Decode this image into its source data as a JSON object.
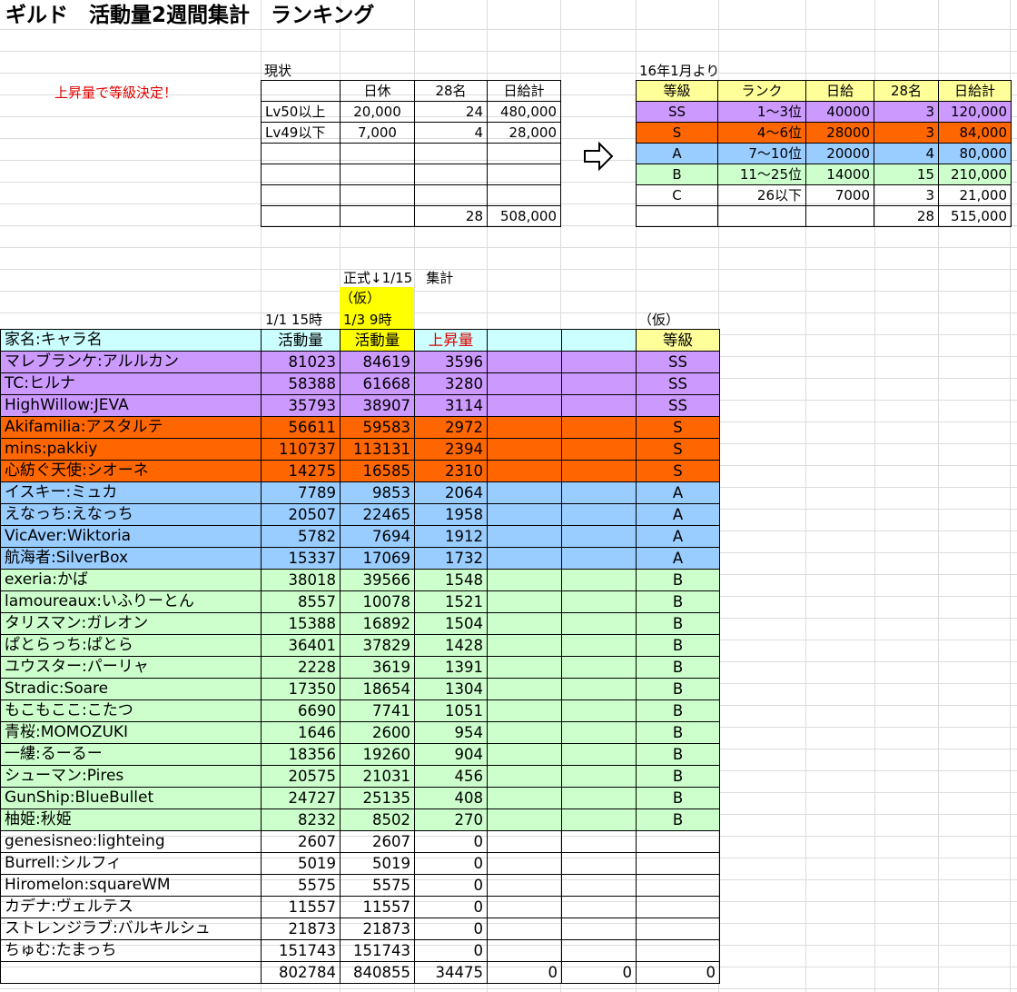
{
  "title": "ギルド　活動量2週間集計　ランキング",
  "note": "上昇量で等級決定！",
  "current": {
    "label": "現状",
    "headers": [
      "",
      "日休",
      "28名",
      "日給計"
    ],
    "rows": [
      [
        "Lv50以上",
        "20,000",
        "24",
        "480,000"
      ],
      [
        "Lv49以下",
        "7,000",
        "4",
        "28,000"
      ],
      [
        "",
        "",
        "",
        ""
      ],
      [
        "",
        "",
        "",
        ""
      ],
      [
        "",
        "",
        "",
        ""
      ],
      [
        "",
        "",
        "28",
        "508,000"
      ]
    ]
  },
  "arrow_icon": "right-arrow-icon",
  "future": {
    "label": "16年1月より",
    "headers": [
      "等級",
      "ランク",
      "日給",
      "28名",
      "日給計"
    ],
    "rows": [
      [
        "SS",
        "1～3位",
        "40000",
        "3",
        "120,000"
      ],
      [
        "S",
        "4～6位",
        "28000",
        "3",
        "84,000"
      ],
      [
        "A",
        "7～10位",
        "20000",
        "4",
        "80,000"
      ],
      [
        "B",
        "11～25位",
        "14000",
        "15",
        "210,000"
      ],
      [
        "C",
        "26以下",
        "7000",
        "3",
        "21,000"
      ],
      [
        "",
        "",
        "",
        "28",
        "515,000"
      ]
    ]
  },
  "labels": {
    "official": "正式↓1/15　集計",
    "kari1": "（仮）",
    "date1": "1/1 15時",
    "date2": "1/3 9時",
    "kari2": "（仮）"
  },
  "main_headers": [
    "家名:キャラ名",
    "活動量",
    "活動量",
    "上昇量",
    "",
    "",
    "等級"
  ],
  "main_rows": [
    {
      "name": "マレブランケ:アルルカン",
      "a": "81023",
      "b": "84619",
      "up": "3596",
      "rank": "SS",
      "tier": "SS"
    },
    {
      "name": "TC:ヒルナ",
      "a": "58388",
      "b": "61668",
      "up": "3280",
      "rank": "SS",
      "tier": "SS"
    },
    {
      "name": "HighWillow:JEVA",
      "a": "35793",
      "b": "38907",
      "up": "3114",
      "rank": "SS",
      "tier": "SS"
    },
    {
      "name": "Akifamilia:アスタルテ",
      "a": "56611",
      "b": "59583",
      "up": "2972",
      "rank": "S",
      "tier": "S"
    },
    {
      "name": "mins:pakkiy",
      "a": "110737",
      "b": "113131",
      "up": "2394",
      "rank": "S",
      "tier": "S"
    },
    {
      "name": "心紡ぐ天使:シオーネ",
      "a": "14275",
      "b": "16585",
      "up": "2310",
      "rank": "S",
      "tier": "S"
    },
    {
      "name": "イスキー:ミュカ",
      "a": "7789",
      "b": "9853",
      "up": "2064",
      "rank": "A",
      "tier": "A"
    },
    {
      "name": "えなっち:えなっち",
      "a": "20507",
      "b": "22465",
      "up": "1958",
      "rank": "A",
      "tier": "A"
    },
    {
      "name": "VicAver:Wiktoria",
      "a": "5782",
      "b": "7694",
      "up": "1912",
      "rank": "A",
      "tier": "A"
    },
    {
      "name": "航海者:SilverBox",
      "a": "15337",
      "b": "17069",
      "up": "1732",
      "rank": "A",
      "tier": "A"
    },
    {
      "name": "exeria:かば",
      "a": "38018",
      "b": "39566",
      "up": "1548",
      "rank": "B",
      "tier": "B"
    },
    {
      "name": "lamoureaux:いふりーとん",
      "a": "8557",
      "b": "10078",
      "up": "1521",
      "rank": "B",
      "tier": "B"
    },
    {
      "name": "タリスマン:ガレオン",
      "a": "15388",
      "b": "16892",
      "up": "1504",
      "rank": "B",
      "tier": "B"
    },
    {
      "name": "ぱとらっち:ぱとら",
      "a": "36401",
      "b": "37829",
      "up": "1428",
      "rank": "B",
      "tier": "B"
    },
    {
      "name": "ユウスター:パーリャ",
      "a": "2228",
      "b": "3619",
      "up": "1391",
      "rank": "B",
      "tier": "B"
    },
    {
      "name": "Stradic:Soare",
      "a": "17350",
      "b": "18654",
      "up": "1304",
      "rank": "B",
      "tier": "B"
    },
    {
      "name": "もこもここ:こたつ",
      "a": "6690",
      "b": "7741",
      "up": "1051",
      "rank": "B",
      "tier": "B"
    },
    {
      "name": "青桜:MOMOZUKI",
      "a": "1646",
      "b": "2600",
      "up": "954",
      "rank": "B",
      "tier": "B"
    },
    {
      "name": "一縷:るーるー",
      "a": "18356",
      "b": "19260",
      "up": "904",
      "rank": "B",
      "tier": "B"
    },
    {
      "name": "シューマン:Pires",
      "a": "20575",
      "b": "21031",
      "up": "456",
      "rank": "B",
      "tier": "B"
    },
    {
      "name": "GunShip:BlueBullet",
      "a": "24727",
      "b": "25135",
      "up": "408",
      "rank": "B",
      "tier": "B"
    },
    {
      "name": "柚姫:秋姫",
      "a": "8232",
      "b": "8502",
      "up": "270",
      "rank": "B",
      "tier": "B"
    },
    {
      "name": "genesisneo:lighteing",
      "a": "2607",
      "b": "2607",
      "up": "0",
      "rank": "",
      "tier": "none"
    },
    {
      "name": "Burrell:シルフィ",
      "a": "5019",
      "b": "5019",
      "up": "0",
      "rank": "",
      "tier": "none"
    },
    {
      "name": "Hiromelon:squareWM",
      "a": "5575",
      "b": "5575",
      "up": "0",
      "rank": "",
      "tier": "none"
    },
    {
      "name": "カデナ:ヴェルテス",
      "a": "11557",
      "b": "11557",
      "up": "0",
      "rank": "",
      "tier": "none"
    },
    {
      "name": "ストレンジラブ:バルキルシュ",
      "a": "21873",
      "b": "21873",
      "up": "0",
      "rank": "",
      "tier": "none"
    },
    {
      "name": "ちゅむ:たまっち",
      "a": "151743",
      "b": "151743",
      "up": "0",
      "rank": "",
      "tier": "none"
    }
  ],
  "main_total": [
    "",
    "802784",
    "840855",
    "34475",
    "0",
    "0",
    "0"
  ],
  "colors": {
    "SS": "#cc99ff",
    "S": "#ff6600",
    "A": "#99ccff",
    "B": "#ccffcc",
    "header": "#ccffff",
    "header_yellow": "#ffff99",
    "highlight": "#ffff00",
    "accent_red": "#e00000"
  }
}
